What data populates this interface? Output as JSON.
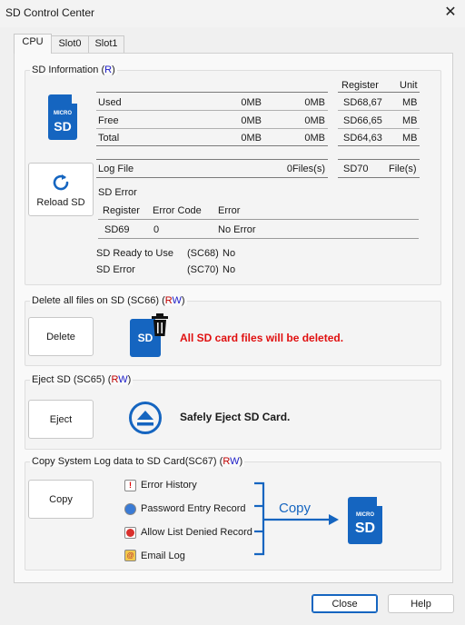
{
  "window": {
    "title": "SD Control Center",
    "close_glyph": "✕"
  },
  "tabs": [
    {
      "label": "CPU",
      "active": true
    },
    {
      "label": "Slot0",
      "active": false
    },
    {
      "label": "Slot1",
      "active": false
    }
  ],
  "sd_info": {
    "title": "SD Information",
    "access_open": "(",
    "access_r": "R",
    "access_close": ")",
    "card_small": "MICRO",
    "card_big": "SD",
    "reload_label": "Reload SD",
    "col_register": "Register",
    "col_unit": "Unit",
    "rows": [
      {
        "label": "Used",
        "v1": "0MB",
        "v2": "0MB",
        "register": "SD68,67",
        "unit": "MB"
      },
      {
        "label": "Free",
        "v1": "0MB",
        "v2": "0MB",
        "register": "SD66,65",
        "unit": "MB"
      },
      {
        "label": "Total",
        "v1": "0MB",
        "v2": "0MB",
        "register": "SD64,63",
        "unit": "MB"
      }
    ],
    "log_file": {
      "label": "Log File",
      "value": "0Files(s)",
      "register": "SD70",
      "unit": "File(s)"
    },
    "sd_error": {
      "title": "SD Error",
      "headers": [
        "Register",
        "Error Code",
        "Error"
      ],
      "row": [
        "SD69",
        "0",
        "No Error"
      ]
    },
    "status": [
      {
        "label": "SD Ready to Use",
        "reg": "(SC68)",
        "value": "No"
      },
      {
        "label": "SD Error",
        "reg": "(SC70)",
        "value": "No"
      }
    ]
  },
  "delete": {
    "title": "Delete all files on SD (SC66)",
    "button": "Delete",
    "message": "All SD card files will be deleted.",
    "card_big": "SD",
    "access": {
      "open": "(",
      "r": "R",
      "w": "W",
      "close": ")"
    },
    "colors": {
      "warning": "#e01010"
    }
  },
  "eject": {
    "title": "Eject SD (SC65)",
    "button": "Eject",
    "message": "Safely Eject SD Card.",
    "access": {
      "open": "(",
      "r": "R",
      "w": "W",
      "close": ")"
    }
  },
  "copy": {
    "title": "Copy System Log data to SD Card(SC67)",
    "button": "Copy",
    "arrow_label": "Copy",
    "card_small": "MICRO",
    "card_big": "SD",
    "access": {
      "open": "(",
      "r": "R",
      "w": "W",
      "close": ")"
    },
    "items": [
      {
        "label": "Error History",
        "icon": "error-history-icon"
      },
      {
        "label": "Password Entry Record",
        "icon": "password-record-icon"
      },
      {
        "label": "Allow List Denied Record",
        "icon": "denied-record-icon"
      },
      {
        "label": "Email Log",
        "icon": "email-log-icon"
      }
    ]
  },
  "footer": {
    "close": "Close",
    "help": "Help"
  },
  "colors": {
    "accent": "#1565c0",
    "read": "#c00000",
    "write": "#1c1cc8"
  }
}
